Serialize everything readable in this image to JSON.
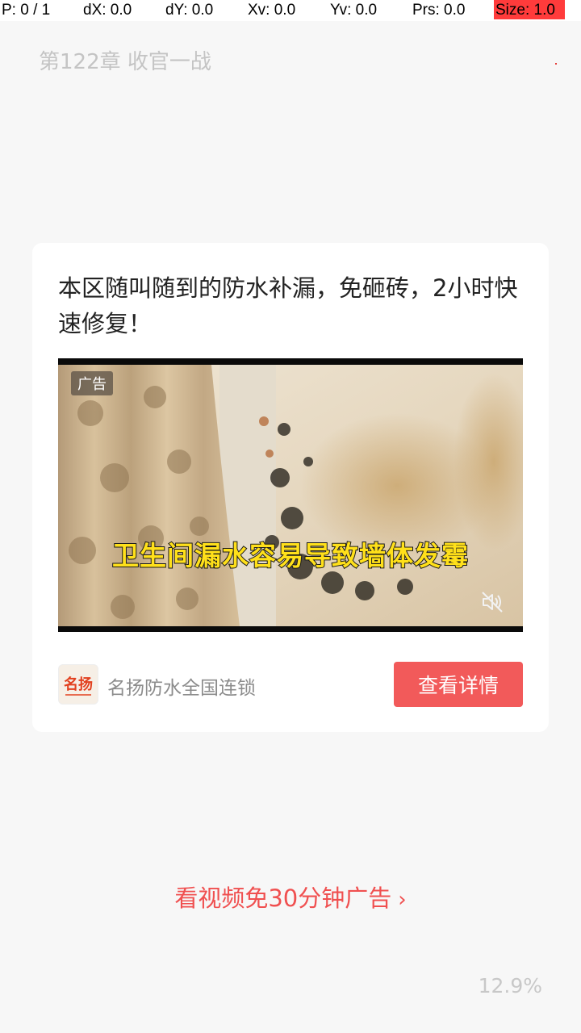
{
  "debug_overlay": {
    "pointer": "P: 0 / 1",
    "dx": "dX: 0.0",
    "dy": "dY: 0.0",
    "xv": "Xv: 0.0",
    "yv": "Yv: 0.0",
    "prs": "Prs: 0.0",
    "size": "Size: 1.0",
    "size_highlight_color": "#ff3b3b"
  },
  "reader": {
    "chapter_title": "第122章 收官一战",
    "progress_percent": "12.9%"
  },
  "ad": {
    "headline": "本区随叫随到的防水补漏，免砸砖，2小时快速修复！",
    "tag": "广告",
    "video_caption": "卫生间漏水容易导致墙体发霉",
    "video_muted": true,
    "advertiser_name": "名扬防水全国连锁",
    "logo_text": "名扬",
    "cta_label": "查看详情",
    "cta_color": "#f25a5a"
  },
  "footer": {
    "watch_video_label": "看视频免30分钟广告",
    "watch_video_color": "#f05050",
    "chevron_icon": "chevron-right-icon"
  }
}
